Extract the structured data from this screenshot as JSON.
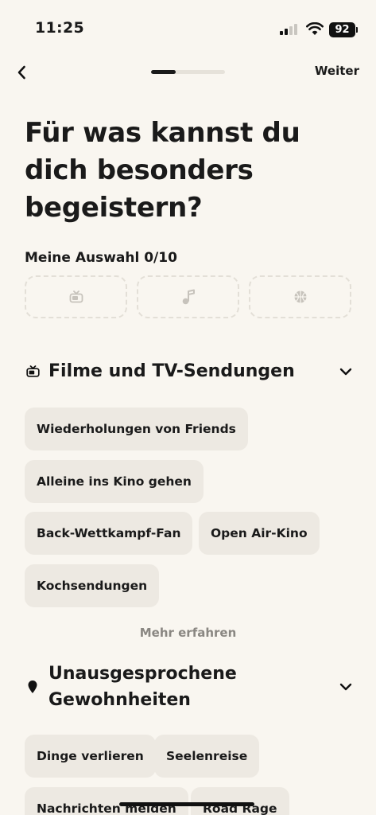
{
  "status_bar": {
    "time": "11:25",
    "battery": "92"
  },
  "nav": {
    "next_label": "Weiter",
    "progress_fraction": 0.33
  },
  "title": "Für was kannst du dich besonders begeistern?",
  "selection_label": "Meine Auswahl 0/10",
  "slots": [
    {
      "icon": "tv-icon"
    },
    {
      "icon": "music-note-icon"
    },
    {
      "icon": "basketball-icon"
    }
  ],
  "sections": [
    {
      "title": "Filme und TV-Sendungen",
      "icon": "tv-icon",
      "chips": [
        "Wiederholungen von Friends",
        "Alleine ins Kino gehen",
        "Back-Wettkampf-Fan",
        "Open Air-Kino",
        "Kochsendungen"
      ],
      "more_label": "Mehr erfahren"
    },
    {
      "title": "Unausgesprochene Gewohnheiten",
      "icon": "location-pin-icon",
      "chips": [
        "Dinge verlieren",
        "Seelenreise",
        "Nachrichten melden",
        "Road Rage"
      ]
    }
  ],
  "colors": {
    "background": "#f9f6f0",
    "chip": "#ede9e2",
    "text": "#1a1a1a",
    "muted": "#8a8782",
    "dashed_border": "#e3dfd7"
  }
}
